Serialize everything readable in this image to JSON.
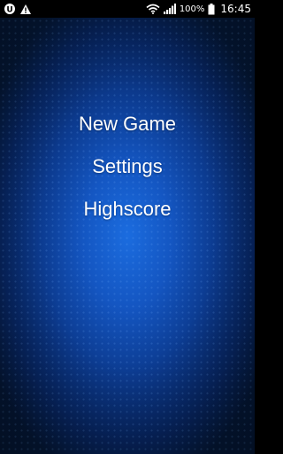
{
  "status_bar": {
    "battery_percent": "100%",
    "time": "16:45",
    "icons": {
      "left": [
        "app-notification-icon",
        "warning-icon"
      ],
      "right": [
        "wifi-icon",
        "signal-icon",
        "battery-icon"
      ]
    }
  },
  "menu": {
    "items": [
      {
        "label": "New Game"
      },
      {
        "label": "Settings"
      },
      {
        "label": "Highscore"
      }
    ]
  },
  "colors": {
    "background_center": "#1b6cdf",
    "background_edge": "#041736",
    "text": "#ffffff",
    "status_bar": "#000000"
  }
}
